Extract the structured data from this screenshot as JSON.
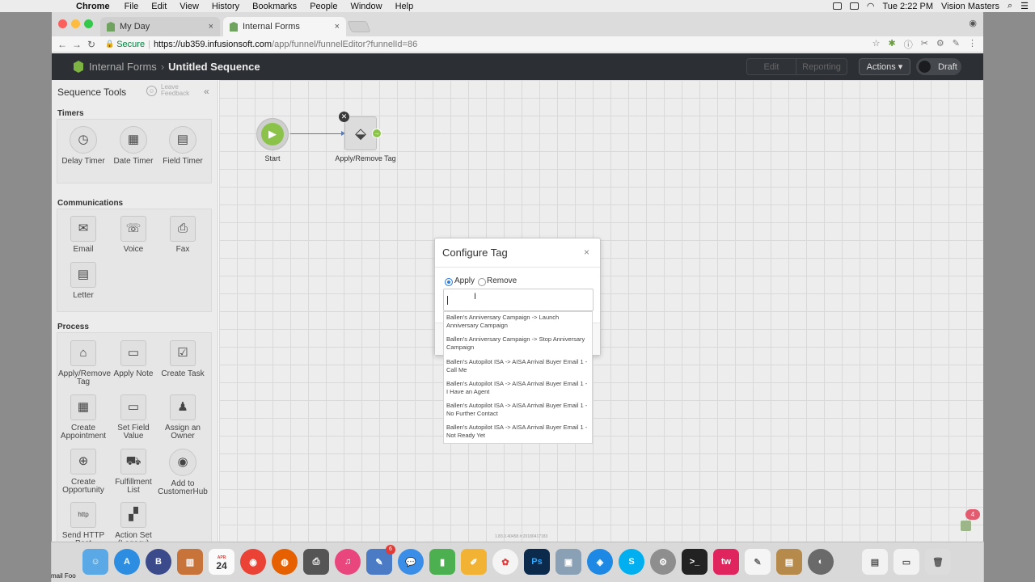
{
  "menubar": {
    "app": "Chrome",
    "items": [
      "File",
      "Edit",
      "View",
      "History",
      "Bookmarks",
      "People",
      "Window",
      "Help"
    ],
    "clock": "Tue 2:22 PM",
    "user": "Vision Masters"
  },
  "browser": {
    "tabs": [
      {
        "title": "My Day"
      },
      {
        "title": "Internal Forms"
      }
    ],
    "address": {
      "secure_label": "Secure",
      "host": "https://ub359.infusionsoft.com",
      "path": "/app/funnel/funnelEditor?funnelId=86"
    }
  },
  "app_header": {
    "crumb_parent": "Internal Forms",
    "crumb_separator": "›",
    "title": "Untitled Sequence",
    "edit_label": "Edit",
    "reporting_label": "Reporting",
    "actions_label": "Actions ▾",
    "draft_label": "Draft"
  },
  "sidebar": {
    "title": "Sequence Tools",
    "feedback_line1": "Leave",
    "feedback_line2": "Feedback",
    "sections": {
      "timers": {
        "title": "Timers",
        "tools": [
          {
            "label": "Delay Timer",
            "icon": "clock-icon"
          },
          {
            "label": "Date Timer",
            "icon": "calendar-icon"
          },
          {
            "label": "Field Timer",
            "icon": "field-calendar-icon"
          }
        ]
      },
      "communications": {
        "title": "Communications",
        "tools": [
          {
            "label": "Email",
            "icon": "envelope-icon"
          },
          {
            "label": "Voice",
            "icon": "phone-icon"
          },
          {
            "label": "Fax",
            "icon": "fax-icon"
          },
          {
            "label": "Letter",
            "icon": "letter-icon"
          }
        ]
      },
      "process": {
        "title": "Process",
        "tools": [
          {
            "label": "Apply/Remove Tag",
            "icon": "tag-icon"
          },
          {
            "label": "Apply Note",
            "icon": "note-icon"
          },
          {
            "label": "Create Task",
            "icon": "checkbox-icon"
          },
          {
            "label": "Create Appointment",
            "icon": "appointment-icon"
          },
          {
            "label": "Set Field Value",
            "icon": "field-value-icon"
          },
          {
            "label": "Assign an Owner",
            "icon": "owner-icon"
          },
          {
            "label": "Create Opportunity",
            "icon": "opportunity-icon"
          },
          {
            "label": "Fulfillment List",
            "icon": "fulfillment-icon"
          },
          {
            "label": "Add to CustomerHub",
            "icon": "customerhub-icon"
          },
          {
            "label": "Send HTTP Post",
            "icon": "http-icon"
          },
          {
            "label": "Action Set (Legacy)",
            "icon": "clapper-icon"
          }
        ]
      }
    }
  },
  "canvas": {
    "start_label": "Start",
    "tag_node_label": "Apply/Remove Tag",
    "footer_text": "1.83.0.40458.#:20180417183"
  },
  "modal": {
    "title": "Configure Tag",
    "close": "×",
    "apply_label": "Apply",
    "remove_label": "Remove",
    "selected": "Apply",
    "input_value": "",
    "options": [
      "Ballen's Anniversary Campaign -> Launch Anniversary Campaign",
      "Ballen's Anniversary Campaign -> Stop Anniversary Campaign",
      "Ballen's Autopilot ISA -> AISA Arrival Buyer Email 1 - Call Me",
      "Ballen's Autopilot ISA -> AISA Arrival Buyer Email 1 - I Have an Agent",
      "Ballen's Autopilot ISA -> AISA Arrival Buyer Email 1 - No Further Contact",
      "Ballen's Autopilot ISA -> AISA Arrival Buyer Email 1 - Not Ready Yet"
    ]
  },
  "notification_count": "4",
  "dock": {
    "calendar_month": "APR",
    "calendar_day": "24",
    "badge_count": "6",
    "left_label": "mail Foo"
  },
  "colors": {
    "accent": "#2f7de1",
    "brand_green": "#8bc34a",
    "header_bg": "#2c2f33"
  }
}
